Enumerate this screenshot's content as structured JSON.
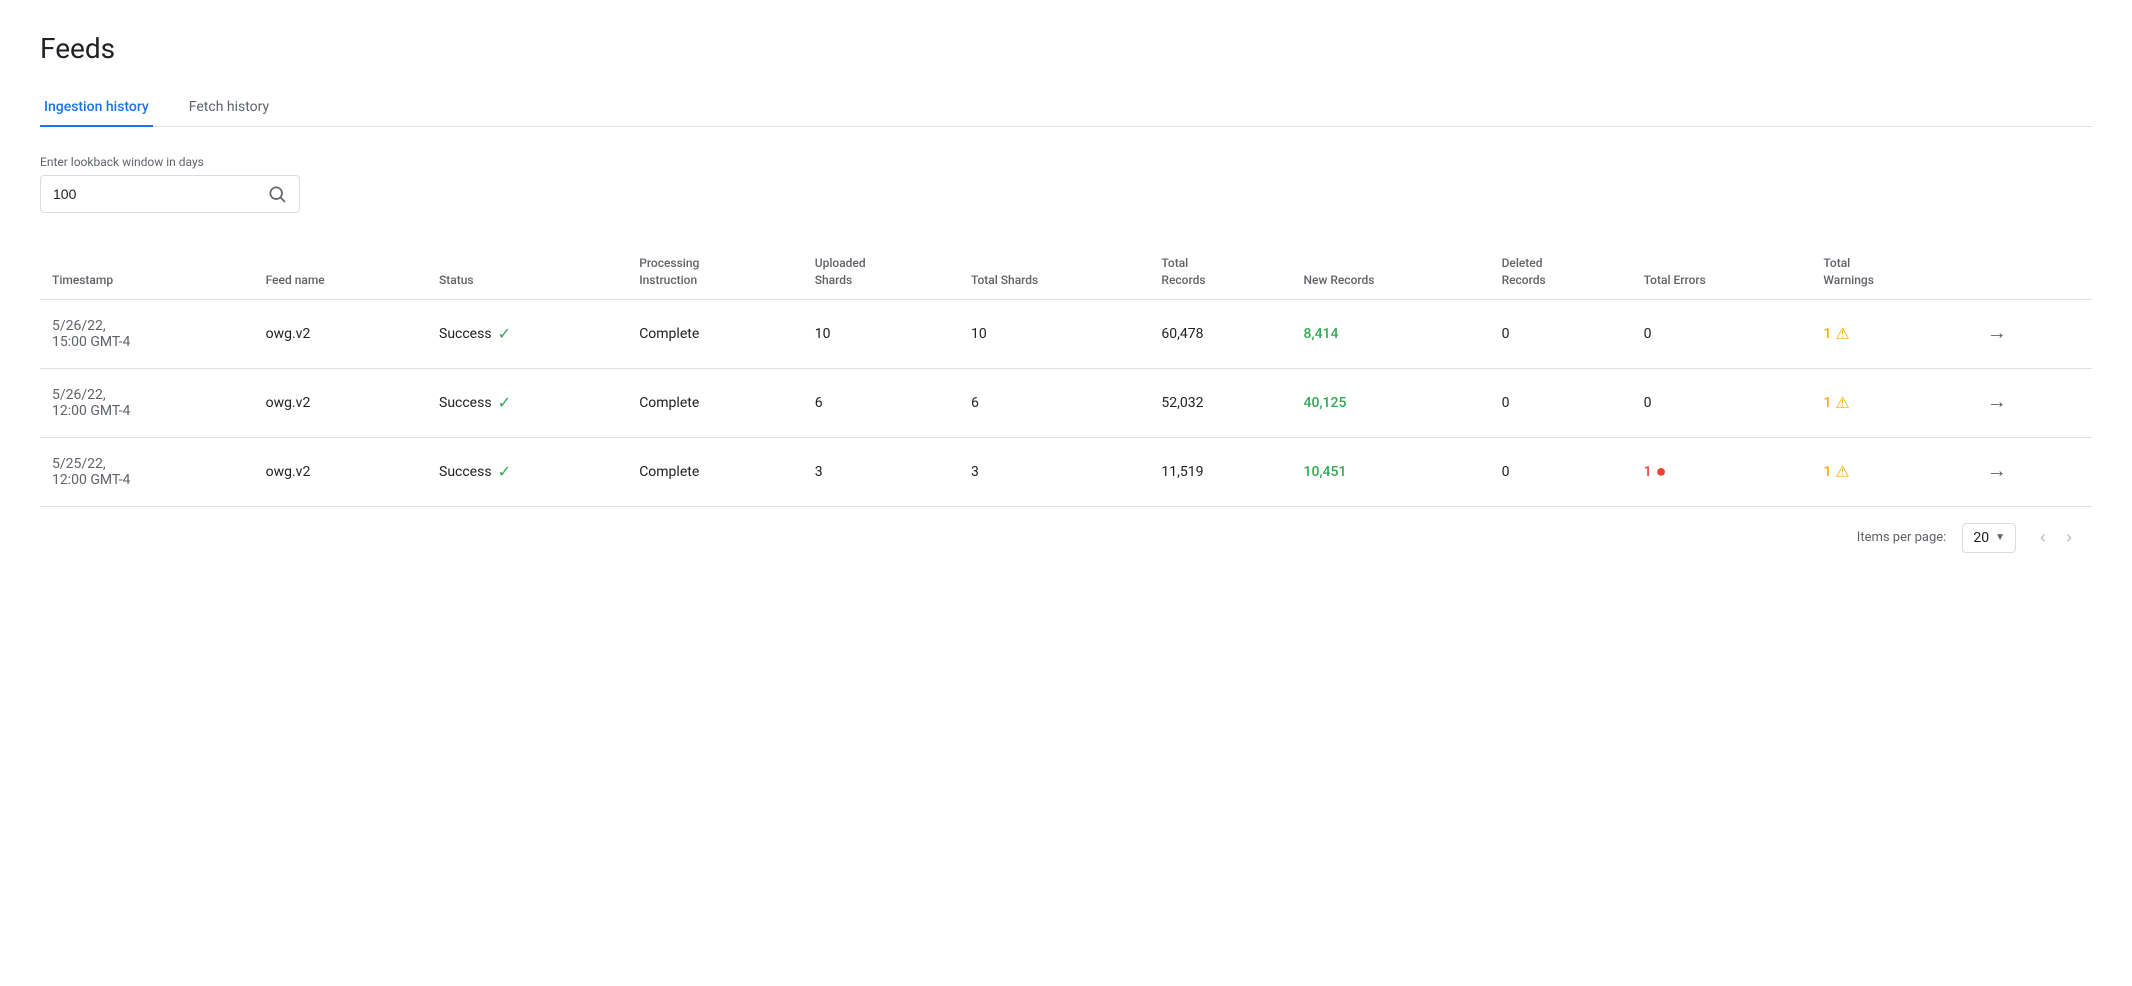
{
  "page": {
    "title": "Feeds"
  },
  "tabs": [
    {
      "id": "ingestion",
      "label": "Ingestion history",
      "active": true
    },
    {
      "id": "fetch",
      "label": "Fetch history",
      "active": false
    }
  ],
  "search": {
    "label": "Enter lookback window in days",
    "value": "100",
    "placeholder": ""
  },
  "table": {
    "columns": [
      {
        "id": "timestamp",
        "label": "Timestamp"
      },
      {
        "id": "feed_name",
        "label": "Feed name"
      },
      {
        "id": "status",
        "label": "Status"
      },
      {
        "id": "processing_instruction",
        "label": "Processing\nInstruction"
      },
      {
        "id": "uploaded_shards",
        "label": "Uploaded\nShards"
      },
      {
        "id": "total_shards",
        "label": "Total Shards"
      },
      {
        "id": "total_records",
        "label": "Total\nRecords"
      },
      {
        "id": "new_records",
        "label": "New Records"
      },
      {
        "id": "deleted_records",
        "label": "Deleted\nRecords"
      },
      {
        "id": "total_errors",
        "label": "Total Errors"
      },
      {
        "id": "total_warnings",
        "label": "Total\nWarnings"
      },
      {
        "id": "action",
        "label": ""
      }
    ],
    "rows": [
      {
        "timestamp": "5/26/22,\n15:00 GMT-4",
        "feed_name": "owg.v2",
        "status": "Success",
        "processing_instruction": "Complete",
        "uploaded_shards": "10",
        "total_shards": "10",
        "total_records": "60,478",
        "new_records": "8,414",
        "new_records_positive": true,
        "deleted_records": "0",
        "total_errors": "0",
        "total_errors_count": 0,
        "total_warnings": "1",
        "total_warnings_count": 1
      },
      {
        "timestamp": "5/26/22,\n12:00 GMT-4",
        "feed_name": "owg.v2",
        "status": "Success",
        "processing_instruction": "Complete",
        "uploaded_shards": "6",
        "total_shards": "6",
        "total_records": "52,032",
        "new_records": "40,125",
        "new_records_positive": true,
        "deleted_records": "0",
        "total_errors": "0",
        "total_errors_count": 0,
        "total_warnings": "1",
        "total_warnings_count": 1
      },
      {
        "timestamp": "5/25/22,\n12:00 GMT-4",
        "feed_name": "owg.v2",
        "status": "Success",
        "processing_instruction": "Complete",
        "uploaded_shards": "3",
        "total_shards": "3",
        "total_records": "11,519",
        "new_records": "10,451",
        "new_records_positive": true,
        "deleted_records": "0",
        "total_errors": "1",
        "total_errors_count": 1,
        "total_warnings": "1",
        "total_warnings_count": 1
      }
    ]
  },
  "pagination": {
    "items_per_page_label": "Items per page:",
    "items_per_page_value": "20"
  },
  "icons": {
    "search": "🔍",
    "check": "✓",
    "warning_triangle": "⚠",
    "error_circle": "●",
    "arrow_right": "→",
    "chevron_left": "‹",
    "chevron_right": "›",
    "dropdown": "▼"
  }
}
